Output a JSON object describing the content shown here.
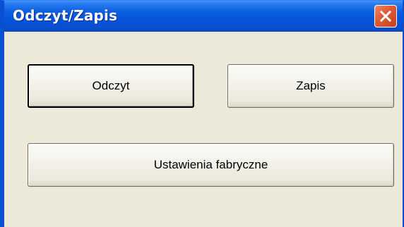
{
  "window": {
    "title": "Odczyt/Zapis",
    "close_icon": "close-icon",
    "colors": {
      "titlebar": "#0850d0",
      "client_background": "#ece9d8",
      "close_button": "#e05b35"
    }
  },
  "buttons": {
    "read_label": "Odczyt",
    "write_label": "Zapis",
    "factory_settings_label": "Ustawienia fabryczne"
  }
}
